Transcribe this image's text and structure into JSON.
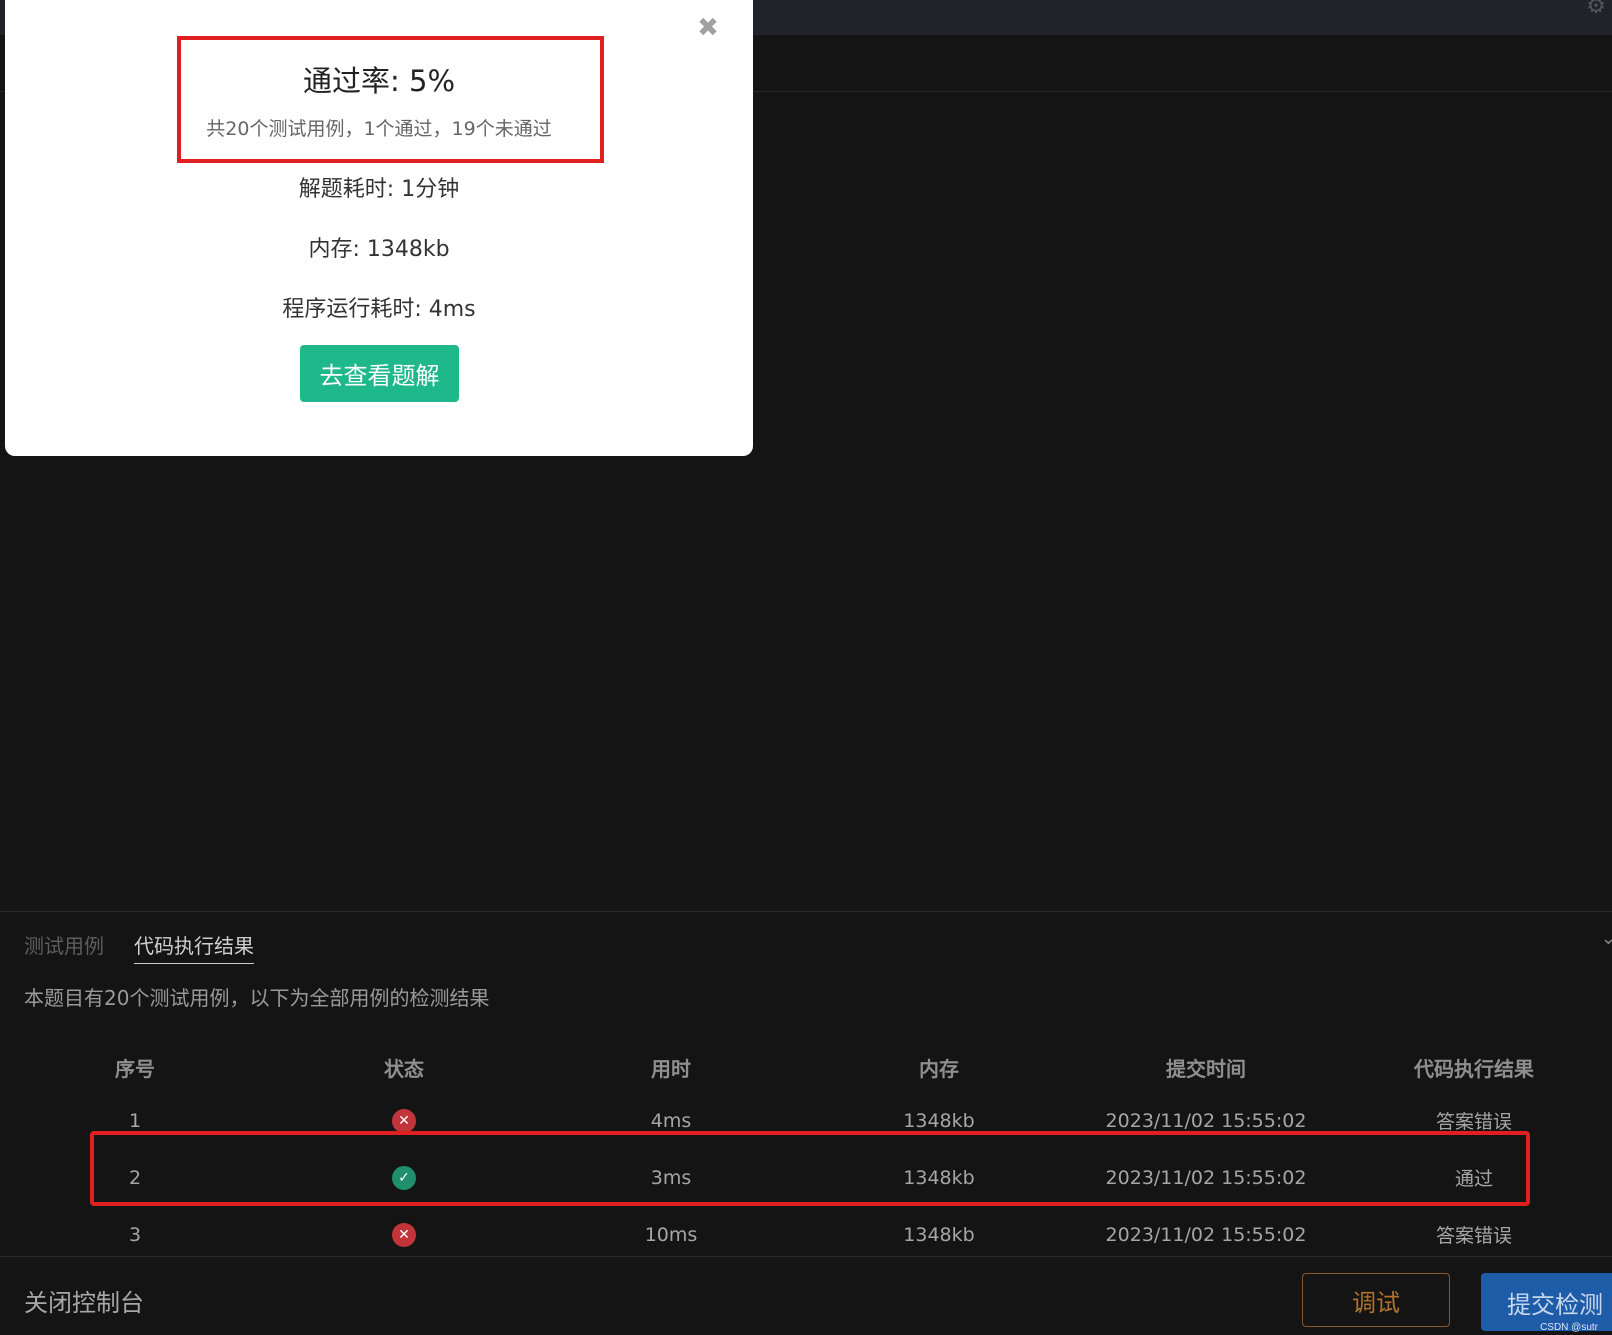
{
  "modal": {
    "close_icon": "close-icon",
    "pass_rate": "通过率: 5%",
    "pass_detail": "共20个测试用例，1个通过，19个未通过",
    "solve_time": "解题耗时: 1分钟",
    "memory": "内存: 1348kb",
    "run_time": "程序运行耗时: 4ms",
    "view_solution_label": "去查看题解"
  },
  "console": {
    "tabs": [
      {
        "label": "测试用例",
        "active": false
      },
      {
        "label": "代码执行结果",
        "active": true
      }
    ],
    "summary": "本题目有20个测试用例，以下为全部用例的检测结果",
    "table": {
      "headers": [
        "序号",
        "状态",
        "用时",
        "内存",
        "提交时间",
        "代码执行结果"
      ],
      "rows": [
        {
          "index": "1",
          "status": "fail",
          "time": "4ms",
          "memory": "1348kb",
          "submitted": "2023/11/02 15:55:02",
          "result": "答案错误"
        },
        {
          "index": "2",
          "status": "pass",
          "time": "3ms",
          "memory": "1348kb",
          "submitted": "2023/11/02 15:55:02",
          "result": "通过"
        },
        {
          "index": "3",
          "status": "fail",
          "time": "10ms",
          "memory": "1348kb",
          "submitted": "2023/11/02 15:55:02",
          "result": "答案错误"
        }
      ]
    }
  },
  "footer": {
    "close_console_label": "关闭控制台",
    "debug_label": "调试",
    "submit_label": "提交检测",
    "watermark": "CSDN @sutr"
  },
  "colors": {
    "accent_green": "#1fb88a",
    "fail_red": "#c0343a",
    "pass_green": "#1f8f6c",
    "annotation_red": "#e02020",
    "submit_blue": "#1f5ca8",
    "debug_orange": "#b1702c"
  }
}
